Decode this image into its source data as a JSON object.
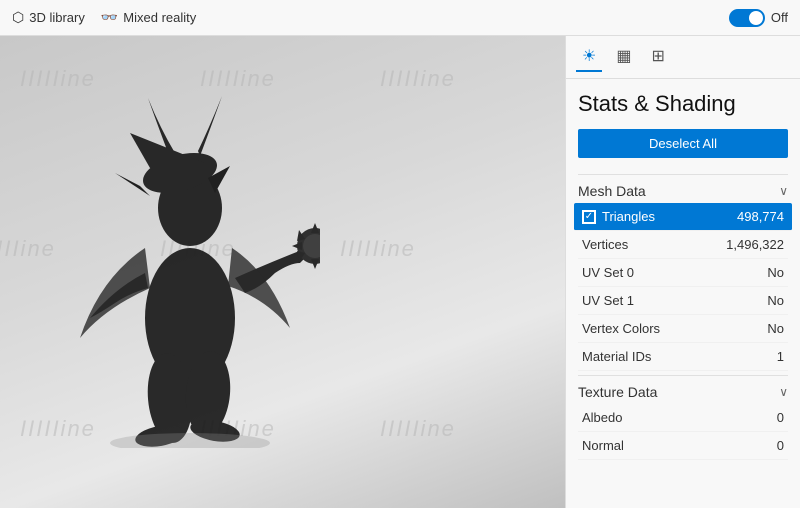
{
  "topbar": {
    "library_label": "3D library",
    "mixed_reality_label": "Mixed reality",
    "toggle_state": "Off",
    "toggle_on": false
  },
  "panel": {
    "title": "Stats & Shading",
    "deselect_button": "Deselect All",
    "tabs": [
      {
        "label": "☀",
        "id": "shading",
        "active": true
      },
      {
        "label": "▦",
        "id": "grid",
        "active": false
      },
      {
        "label": "⊞",
        "id": "dots",
        "active": false
      }
    ],
    "sections": [
      {
        "id": "mesh-data",
        "title": "Mesh Data",
        "expanded": true,
        "rows": [
          {
            "label": "Triangles",
            "value": "498,774",
            "highlighted": true,
            "has_checkbox": true
          },
          {
            "label": "Vertices",
            "value": "1,496,322",
            "highlighted": false,
            "has_checkbox": false
          },
          {
            "label": "UV Set 0",
            "value": "No",
            "highlighted": false,
            "has_checkbox": false
          },
          {
            "label": "UV Set 1",
            "value": "No",
            "highlighted": false,
            "has_checkbox": false
          },
          {
            "label": "Vertex Colors",
            "value": "No",
            "highlighted": false,
            "has_checkbox": false
          },
          {
            "label": "Material IDs",
            "value": "1",
            "highlighted": false,
            "has_checkbox": false
          }
        ]
      },
      {
        "id": "texture-data",
        "title": "Texture Data",
        "expanded": true,
        "rows": [
          {
            "label": "Albedo",
            "value": "0",
            "highlighted": false,
            "has_checkbox": false
          },
          {
            "label": "Normal",
            "value": "0",
            "highlighted": false,
            "has_checkbox": false
          }
        ]
      }
    ]
  },
  "watermarks": [
    "IIIIIine",
    "IIIIIine",
    "IIIIIine",
    "IIIIIine",
    "IIIIIine",
    "IIIIIine",
    "IIIIIine",
    "IIIIIine",
    "IIIIIine"
  ]
}
